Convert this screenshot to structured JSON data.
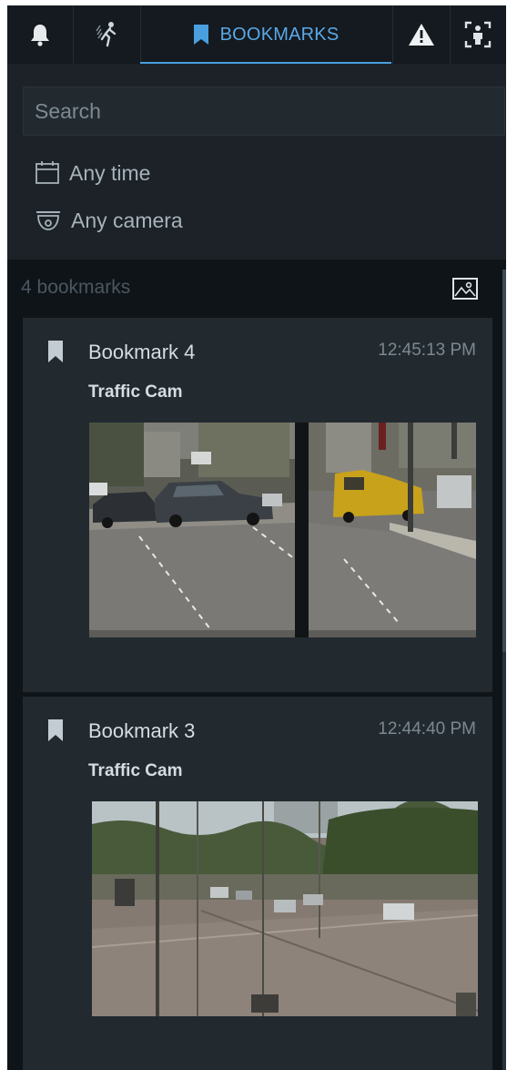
{
  "tabs": [
    {
      "id": "alarms",
      "icon": "bell-icon"
    },
    {
      "id": "motion",
      "icon": "motion-person-icon"
    },
    {
      "id": "bookmarks",
      "icon": "bookmark-icon",
      "label": "BOOKMARKS",
      "active": true
    },
    {
      "id": "alerts",
      "icon": "warning-icon"
    },
    {
      "id": "people",
      "icon": "person-detect-icon"
    }
  ],
  "filters": {
    "search_placeholder": "Search",
    "time_label": "Any time",
    "camera_label": "Any camera"
  },
  "list": {
    "count_label": "4 bookmarks"
  },
  "bookmarks": [
    {
      "title": "Bookmark 4",
      "time": "12:45:13 PM",
      "camera": "Traffic Cam"
    },
    {
      "title": "Bookmark 3",
      "time": "12:44:40 PM",
      "camera": "Traffic Cam"
    }
  ],
  "colors": {
    "accent": "#4a9fde",
    "panel": "#1c2227",
    "card": "#222a30"
  }
}
